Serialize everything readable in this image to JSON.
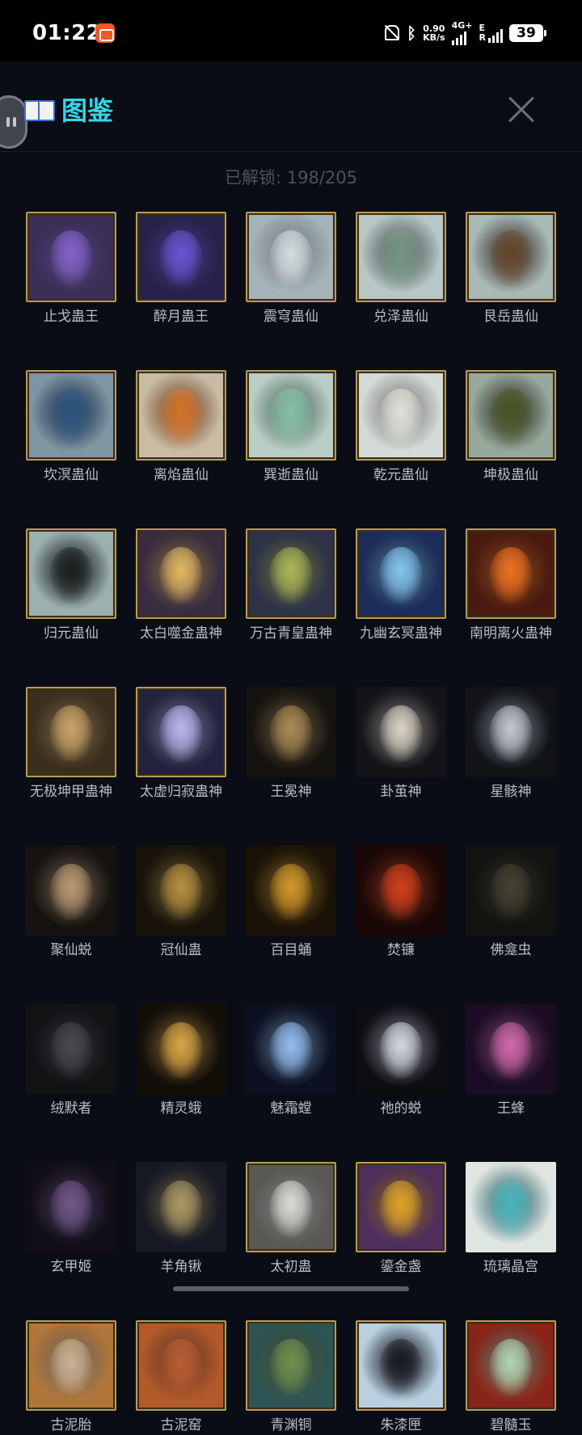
{
  "status_bar": {
    "time": "01:22",
    "net_speed_value": "0.90",
    "net_speed_unit": "KB/s",
    "sim1_tag": "4G+",
    "sim2_tag": "E",
    "sim2_sub": "R",
    "battery": "39"
  },
  "header": {
    "title": "图鉴",
    "unlocked_text": "已解锁: 198/205"
  },
  "items": [
    {
      "name": "止戈蛊王",
      "bg": "#3a2f55",
      "tone": "#8f6bd8",
      "framed": true
    },
    {
      "name": "醉月蛊王",
      "bg": "#28224a",
      "tone": "#6f5ce0",
      "framed": true
    },
    {
      "name": "震穹蛊仙",
      "bg": "#a4b3b8",
      "tone": "#e6eef0",
      "framed": true
    },
    {
      "name": "兑泽蛊仙",
      "bg": "#b8c6c6",
      "tone": "#7fa08c",
      "framed": true
    },
    {
      "name": "艮岳蛊仙",
      "bg": "#a8b9b6",
      "tone": "#6b4c2e",
      "framed": true
    },
    {
      "name": "坎溟蛊仙",
      "bg": "#7f95a4",
      "tone": "#2f5b86",
      "framed": true
    },
    {
      "name": "离焰蛊仙",
      "bg": "#c9bba4",
      "tone": "#e57a2a",
      "framed": true
    },
    {
      "name": "巽逝蛊仙",
      "bg": "#b9cdc4",
      "tone": "#8fcfb0",
      "framed": true
    },
    {
      "name": "乾元蛊仙",
      "bg": "#d4dad6",
      "tone": "#f4f2e8",
      "framed": true
    },
    {
      "name": "坤极蛊仙",
      "bg": "#97a89c",
      "tone": "#4f5a2a",
      "framed": true
    },
    {
      "name": "归元蛊仙",
      "bg": "#9cb0ae",
      "tone": "#1c2220",
      "framed": true
    },
    {
      "name": "太白噬金蛊神",
      "bg": "#3a2c40",
      "tone": "#f2c46a",
      "framed": true
    },
    {
      "name": "万古青皇蛊神",
      "bg": "#2c3248",
      "tone": "#b8c45a",
      "framed": true
    },
    {
      "name": "九幽玄冥蛊神",
      "bg": "#1c2c58",
      "tone": "#8fd4ff",
      "framed": true
    },
    {
      "name": "南明离火蛊神",
      "bg": "#4a1a10",
      "tone": "#ff7a22",
      "framed": true
    },
    {
      "name": "无极坤甲蛊神",
      "bg": "#3a2e1c",
      "tone": "#d8b070",
      "framed": true
    },
    {
      "name": "太虚归寂蛊神",
      "bg": "#22223c",
      "tone": "#c8c4ff",
      "framed": true
    },
    {
      "name": "王冕神",
      "bg": "#15130f",
      "tone": "#b8945a",
      "framed": false
    },
    {
      "name": "卦茧神",
      "bg": "#141418",
      "tone": "#e8e2d0",
      "framed": false
    },
    {
      "name": "星骸神",
      "bg": "#111316",
      "tone": "#cfd6dc",
      "framed": false
    },
    {
      "name": "聚仙蜕",
      "bg": "#15120f",
      "tone": "#c8a47a",
      "framed": false
    },
    {
      "name": "冠仙蛊",
      "bg": "#171309",
      "tone": "#c49a44",
      "framed": false
    },
    {
      "name": "百目蛹",
      "bg": "#1a1206",
      "tone": "#e0a22a",
      "framed": false
    },
    {
      "name": "焚镰",
      "bg": "#1a0806",
      "tone": "#e0441c",
      "framed": false
    },
    {
      "name": "佛龛虫",
      "bg": "#121210",
      "tone": "#4a4632",
      "framed": false
    },
    {
      "name": "绒默者",
      "bg": "#121214",
      "tone": "#4e4e52",
      "framed": false
    },
    {
      "name": "精灵蛾",
      "bg": "#120e08",
      "tone": "#e8b04a",
      "framed": false
    },
    {
      "name": "魅霜螳",
      "bg": "#0c1020",
      "tone": "#9ecaff",
      "framed": false
    },
    {
      "name": "祂的蜕",
      "bg": "#0e0e12",
      "tone": "#e4e6ee",
      "framed": false
    },
    {
      "name": "王蜂",
      "bg": "#1a0c22",
      "tone": "#e070b8",
      "framed": false
    },
    {
      "name": "玄甲姬",
      "bg": "#110e18",
      "tone": "#7a5e92",
      "framed": false
    },
    {
      "name": "羊角锹",
      "bg": "#161824",
      "tone": "#b8a46a",
      "framed": false
    },
    {
      "name": "太初蛊",
      "bg": "#5a5854",
      "tone": "#ecebe6",
      "framed": true
    },
    {
      "name": "鎏金盏",
      "bg": "#4e2e5c",
      "tone": "#f0b02a",
      "framed": true
    },
    {
      "name": "琉璃晶宫",
      "bg": "#dfe6e2",
      "tone": "#4fc2c8",
      "framed": false
    },
    {
      "name": "古泥胎",
      "bg": "#b0763a",
      "tone": "#d8c0a0",
      "framed": true
    },
    {
      "name": "古泥窑",
      "bg": "#b25a2a",
      "tone": "#c66436",
      "framed": true
    },
    {
      "name": "青渊铜",
      "bg": "#2e5454",
      "tone": "#7a9a54",
      "framed": true
    },
    {
      "name": "朱漆匣",
      "bg": "#b8d0e0",
      "tone": "#1a1a22",
      "framed": true
    },
    {
      "name": "碧髓玉",
      "bg": "#8a2418",
      "tone": "#bfe6c0",
      "framed": true
    }
  ]
}
